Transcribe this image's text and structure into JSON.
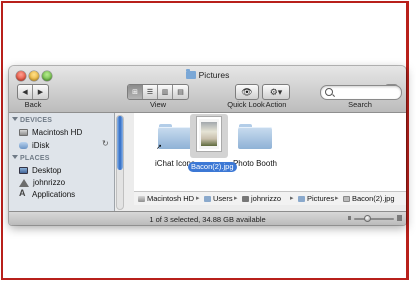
{
  "window": {
    "title": "Pictures"
  },
  "toolbar": {
    "back_label": "Back",
    "view_label": "View",
    "quicklook_label": "Quick Look",
    "action_label": "Action",
    "search_label": "Search",
    "search_placeholder": ""
  },
  "sidebar": {
    "devices_header": "DEVICES",
    "devices": [
      {
        "label": "Macintosh HD",
        "icon": "hard-drive-icon"
      },
      {
        "label": "iDisk",
        "icon": "idisk-icon"
      }
    ],
    "places_header": "PLACES",
    "places": [
      {
        "label": "Desktop",
        "icon": "desktop-icon"
      },
      {
        "label": "johnrizzo",
        "icon": "home-icon"
      },
      {
        "label": "Applications",
        "icon": "applications-icon"
      }
    ]
  },
  "items": [
    {
      "label": "iChat Icons",
      "type": "alias-folder"
    },
    {
      "label": "Photo Booth",
      "type": "folder"
    },
    {
      "label": "Bacon(2).jpg",
      "type": "image",
      "selected": true
    }
  ],
  "path": [
    "Macintosh HD",
    "Users",
    "johnrizzo",
    "Pictures",
    "Bacon(2).jpg"
  ],
  "status": {
    "text": "1 of 3 selected, 34.88 GB available"
  },
  "colors": {
    "frame": "#b8201b",
    "selection": "#3c78d5"
  }
}
